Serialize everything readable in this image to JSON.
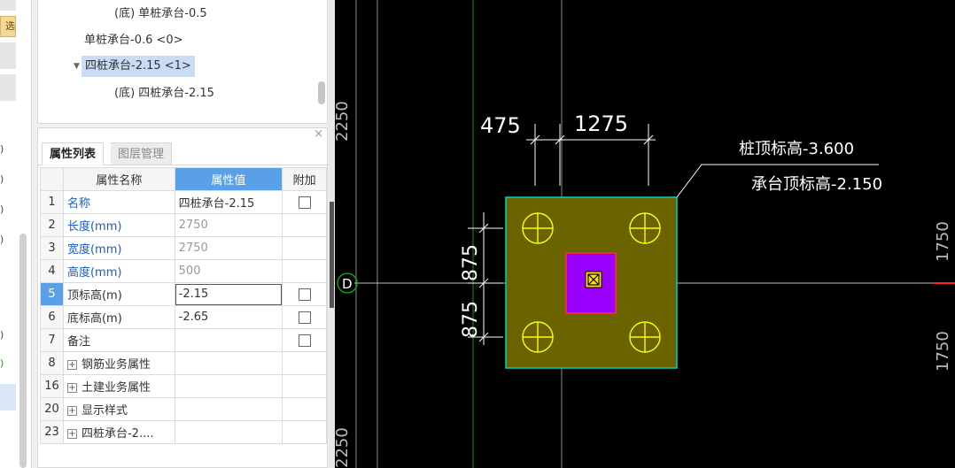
{
  "left_strip": {
    "badge_text": "选用",
    "glyphs": [
      ")",
      ")",
      ")",
      ")",
      ")",
      ")"
    ]
  },
  "tree": {
    "items": [
      {
        "label": "(底) 单桩承台-0.5"
      },
      {
        "label": "单桩承台-0.6 <0>"
      },
      {
        "label": "四桩承台-2.15 <1>"
      },
      {
        "label": "(底) 四桩承台-2.15"
      }
    ]
  },
  "panel": {
    "close": "×",
    "tabs": [
      {
        "label": "属性列表"
      },
      {
        "label": "图层管理"
      }
    ],
    "headers": {
      "name": "属性名称",
      "value": "属性值",
      "extra": "附加"
    },
    "rows": [
      {
        "no": "1",
        "name": "名称",
        "value": "四桩承台-2.15"
      },
      {
        "no": "2",
        "name": "长度(mm)",
        "value": "2750"
      },
      {
        "no": "3",
        "name": "宽度(mm)",
        "value": "2750"
      },
      {
        "no": "4",
        "name": "高度(mm)",
        "value": "500"
      },
      {
        "no": "5",
        "name": "顶标高(m)",
        "value": "-2.15"
      },
      {
        "no": "6",
        "name": "底标高(m)",
        "value": "-2.65"
      },
      {
        "no": "7",
        "name": "备注",
        "value": ""
      },
      {
        "no": "8",
        "name": "钢筋业务属性",
        "value": ""
      },
      {
        "no": "16",
        "name": "土建业务属性",
        "value": ""
      },
      {
        "no": "20",
        "name": "显示样式",
        "value": ""
      },
      {
        "no": "23",
        "name": "四桩承台-2....",
        "value": ""
      }
    ]
  },
  "cad": {
    "dims": {
      "top_a": "475",
      "top_b": "1275",
      "left_a": "875",
      "left_b": "875"
    },
    "annotation": {
      "line1": "桩顶标高-3.600",
      "line2": "承台顶标高-2.150"
    },
    "axis_label": "D",
    "edge_text": {
      "left_top": "2250",
      "left_bottom": "2250",
      "right_top": "1750",
      "right_bottom": "1750"
    },
    "colors": {
      "pile_cap": "#6b6300",
      "cap_border": "#00d0d0",
      "column": "#9b00ff",
      "pile": "#ffff00",
      "dims": "#ffffff",
      "axis": "#c0c0c0",
      "grid_green": "#00a000"
    }
  }
}
